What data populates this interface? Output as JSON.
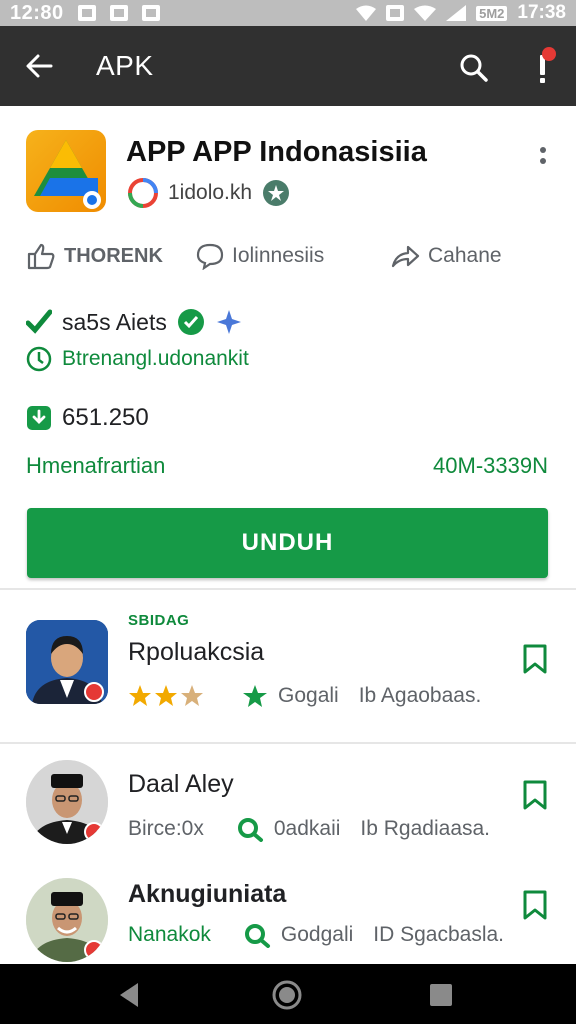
{
  "status_bar": {
    "time_left": "12:80",
    "badge_text": "5M2",
    "time_right": "17:38"
  },
  "app_bar": {
    "title": "APK"
  },
  "app": {
    "name": "APP APP Indonasisiia",
    "developer": "1idolo.kh",
    "actions": [
      {
        "label": "THORENK",
        "icon": "thumbs-up-icon"
      },
      {
        "label": "Iolinnesiis",
        "icon": "comment-icon"
      },
      {
        "label": "Cahane",
        "icon": "share-icon"
      }
    ],
    "rating_text": "sa5s Aiets",
    "category_text": "Btrenangl.udonankit",
    "size_value": "651.250",
    "meta_left": "Hmenafrartian",
    "meta_right": "40M-3339N",
    "download_label": "UNDUH"
  },
  "list": [
    {
      "kicker": "SBIDAG",
      "title": "Rpoluakcsia",
      "meta1": "",
      "meta2": "Gogali",
      "meta3": "Ib Agaobaas.",
      "has_stars": true,
      "avatar": "person-avatar-suit"
    },
    {
      "kicker": "",
      "title": "Daal Aley",
      "meta1": "Birce:0x",
      "meta2": "0adkaii",
      "meta3": "Ib Rgadiaasa.",
      "has_stars": false,
      "avatar": "person-avatar-cap"
    },
    {
      "kicker": "",
      "title": "Aknugiuniata",
      "meta1": "Nanakok",
      "meta2": "Godgali",
      "meta3": "ID Sgacbasla.",
      "has_stars": false,
      "avatar": "person-avatar-cap"
    }
  ],
  "colors": {
    "primary_green": "#169a47",
    "app_bar": "#303030",
    "status_bar": "#bdbdbd",
    "star_gold": "#f2a900"
  }
}
